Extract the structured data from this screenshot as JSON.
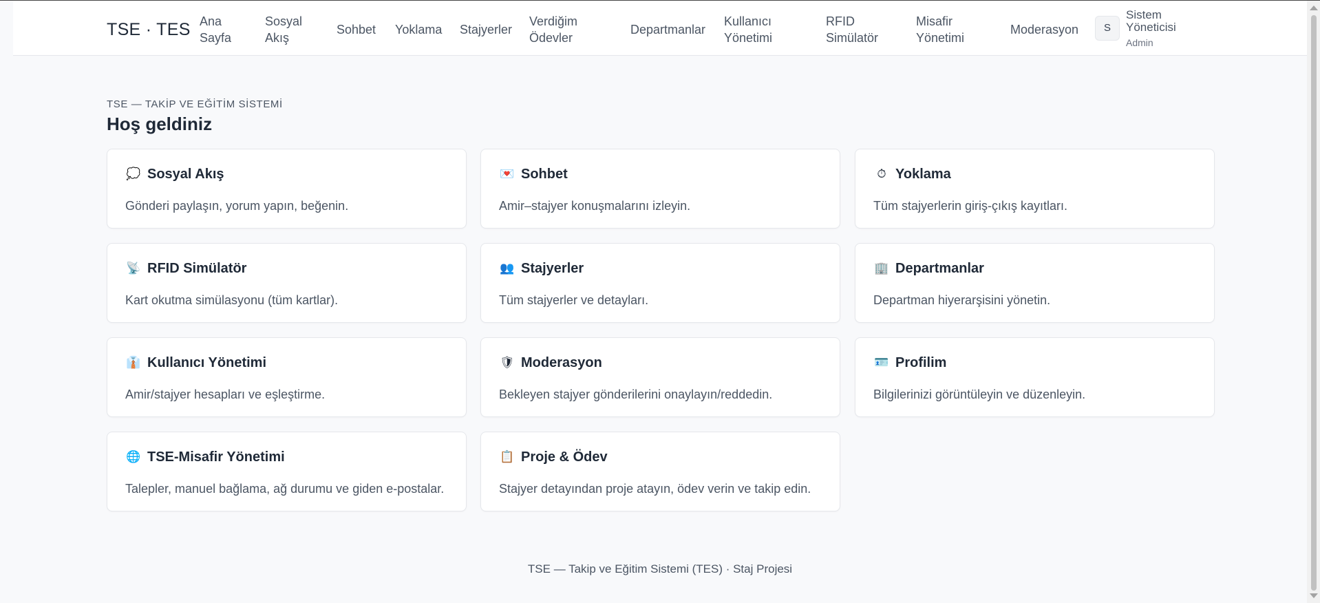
{
  "nav": {
    "brand": "TSE · TES",
    "items": [
      {
        "line1": "Ana",
        "line2": "Sayfa"
      },
      {
        "line1": "Sosyal",
        "line2": "Akış"
      },
      {
        "line1": "Sohbet",
        "line2": ""
      },
      {
        "line1": "Yoklama",
        "line2": ""
      },
      {
        "line1": "Stajyerler",
        "line2": ""
      },
      {
        "line1": "Verdiğim",
        "line2": "Ödevler"
      },
      {
        "line1": "Departmanlar",
        "line2": ""
      },
      {
        "line1": "Kullanıcı",
        "line2": "Yönetimi"
      },
      {
        "line1": "RFID",
        "line2": "Simülatör"
      },
      {
        "line1": "Misafir",
        "line2": "Yönetimi"
      },
      {
        "line1": "Moderasyon",
        "line2": ""
      }
    ],
    "user": {
      "avatar": "S",
      "name_line1": "Sistem",
      "name_line2": "Yöneticisi",
      "role": "Admin"
    }
  },
  "header": {
    "eyebrow": "TSE — TAKİP VE EĞİTİM SİSTEMİ",
    "title": "Hoş geldiniz"
  },
  "cards": [
    {
      "icon": "speech-bubble-icon",
      "glyph": "💭",
      "title": "Sosyal Akış",
      "desc": "Gönderi paylaşın, yorum yapın, beğenin."
    },
    {
      "icon": "heart-letter-icon",
      "glyph": "💌",
      "title": "Sohbet",
      "desc": "Amir–stajyer konuşmalarını izleyin."
    },
    {
      "icon": "stopwatch-icon",
      "glyph": "⏱",
      "title": "Yoklama",
      "desc": "Tüm stajyerlerin giriş-çıkış kayıtları."
    },
    {
      "icon": "satellite-dish-icon",
      "glyph": "📡",
      "title": "RFID Simülatör",
      "desc": "Kart okutma simülasyonu (tüm kartlar)."
    },
    {
      "icon": "people-icon",
      "glyph": "👥",
      "title": "Stajyerler",
      "desc": "Tüm stajyerler ve detayları."
    },
    {
      "icon": "office-building-icon",
      "glyph": "🏢",
      "title": "Departmanlar",
      "desc": "Departman hiyerarşisini yönetin."
    },
    {
      "icon": "office-worker-icon",
      "glyph": "👔",
      "title": "Kullanıcı Yönetimi",
      "desc": "Amir/stajyer hesapları ve eşleştirme."
    },
    {
      "icon": "shield-icon",
      "glyph": "🛡",
      "title": "Moderasyon",
      "desc": "Bekleyen stajyer gönderilerini onaylayın/reddedin."
    },
    {
      "icon": "id-card-icon",
      "glyph": "🪪",
      "title": "Profilim",
      "desc": "Bilgilerinizi görüntüleyin ve düzenleyin."
    },
    {
      "icon": "globe-icon",
      "glyph": "🌐",
      "title": "TSE-Misafir Yönetimi",
      "desc": "Talepler, manuel bağlama, ağ durumu ve giden e-postalar."
    },
    {
      "icon": "clipboard-icon",
      "glyph": "📋",
      "title": "Proje & Ödev",
      "desc": "Stajyer detayından proje atayın, ödev verin ve takip edin."
    }
  ],
  "footer": {
    "text": "TSE — Takip ve Eğitim Sistemi (TES) · Staj Projesi"
  }
}
